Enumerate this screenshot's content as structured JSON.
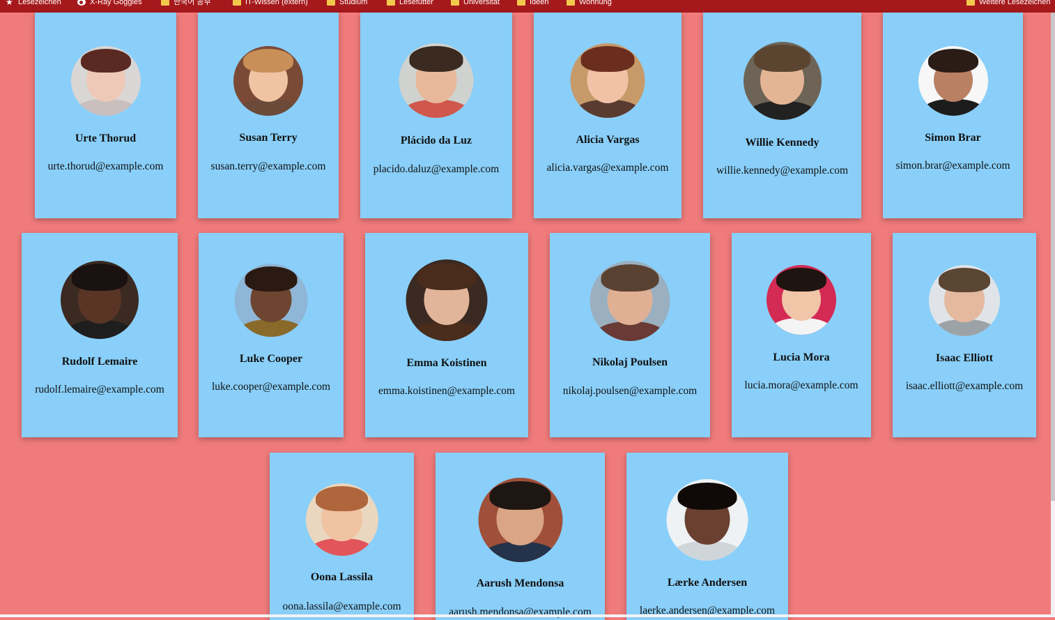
{
  "bookmarks": [
    {
      "label": "Lesezeichen",
      "icon": "star-icon"
    },
    {
      "label": "X-Ray Goggles",
      "icon": "goggles-icon"
    },
    {
      "label": "한국어 공부",
      "icon": "folder-icon"
    },
    {
      "label": "IT-Wissen (extern)",
      "icon": "folder-icon"
    },
    {
      "label": "Studium",
      "icon": "folder-icon"
    },
    {
      "label": "Lesefutter",
      "icon": "folder-icon"
    },
    {
      "label": "Universität",
      "icon": "folder-icon"
    },
    {
      "label": "Ideen",
      "icon": "folder-icon"
    },
    {
      "label": "Wohnung",
      "icon": "folder-icon"
    },
    {
      "label": "Weitere Lesezeichen",
      "icon": "folder-icon"
    }
  ],
  "users": [
    {
      "name": "Urte Thorud",
      "email": "urte.thorud@example.com",
      "avatar": {
        "bg": "#d9d6d6",
        "skin": "#efc9b8",
        "hair": "#5a2a22",
        "shirt": "#c9bfbf"
      }
    },
    {
      "name": "Susan Terry",
      "email": "susan.terry@example.com",
      "avatar": {
        "bg": "#7a4a36",
        "skin": "#f0c3a3",
        "hair": "#c98f58",
        "shirt": "#6b4a3a"
      }
    },
    {
      "name": "Plácido da Luz",
      "email": "placido.daluz@example.com",
      "avatar": {
        "bg": "#cfd2cf",
        "skin": "#e8b89b",
        "hair": "#3a2a1f",
        "shirt": "#d0574c"
      }
    },
    {
      "name": "Alicia Vargas",
      "email": "alicia.vargas@example.com",
      "avatar": {
        "bg": "#c79a6a",
        "skin": "#f1c2a6",
        "hair": "#6b2e1e",
        "shirt": "#5a3b30"
      }
    },
    {
      "name": "Willie Kennedy",
      "email": "willie.kennedy@example.com",
      "avatar": {
        "bg": "#6d6457",
        "skin": "#e4b595",
        "hair": "#5b4530",
        "shirt": "#222222"
      }
    },
    {
      "name": "Simon Brar",
      "email": "simon.brar@example.com",
      "avatar": {
        "bg": "#f7f7f7",
        "skin": "#b98063",
        "hair": "#2b1d16",
        "shirt": "#1c1c1c"
      }
    },
    {
      "name": "Rudolf Lemaire",
      "email": "rudolf.lemaire@example.com",
      "avatar": {
        "bg": "#3b2a22",
        "skin": "#5a3526",
        "hair": "#1a1210",
        "shirt": "#1e1e1e"
      }
    },
    {
      "name": "Luke Cooper",
      "email": "luke.cooper@example.com",
      "avatar": {
        "bg": "#8fb6d6",
        "skin": "#6d4530",
        "hair": "#2b1a12",
        "shirt": "#8a6a2a"
      }
    },
    {
      "name": "Emma Koistinen",
      "email": "emma.koistinen@example.com",
      "avatar": {
        "bg": "#3a2a22",
        "skin": "#e2b59a",
        "hair": "#4a2c1c",
        "shirt": "#4a2c1c"
      }
    },
    {
      "name": "Nikolaj Poulsen",
      "email": "nikolaj.poulsen@example.com",
      "avatar": {
        "bg": "#9ab0c0",
        "skin": "#e0b095",
        "hair": "#5a4232",
        "shirt": "#6a3a36"
      }
    },
    {
      "name": "Lucia Mora",
      "email": "lucia.mora@example.com",
      "avatar": {
        "bg": "#d42b55",
        "skin": "#f0c5a8",
        "hair": "#1e1410",
        "shirt": "#f4f4f4"
      }
    },
    {
      "name": "Isaac Elliott",
      "email": "isaac.elliott@example.com",
      "avatar": {
        "bg": "#e0e4e8",
        "skin": "#e5b99e",
        "hair": "#5b4634",
        "shirt": "#9ca3a8"
      }
    },
    {
      "name": "Oona Lassila",
      "email": "oona.lassila@example.com",
      "avatar": {
        "bg": "#ead7bf",
        "skin": "#f0c3a2",
        "hair": "#b0663c",
        "shirt": "#e2555a"
      }
    },
    {
      "name": "Aarush Mendonsa",
      "email": "aarush.mendonsa@example.com",
      "avatar": {
        "bg": "#a0503a",
        "skin": "#d9a585",
        "hair": "#1e1612",
        "shirt": "#24324a"
      }
    },
    {
      "name": "Lærke Andersen",
      "email": "laerke.andersen@example.com",
      "avatar": {
        "bg": "#eef2f4",
        "skin": "#6a4030",
        "hair": "#0f0a08",
        "shirt": "#cfd6da"
      }
    }
  ]
}
